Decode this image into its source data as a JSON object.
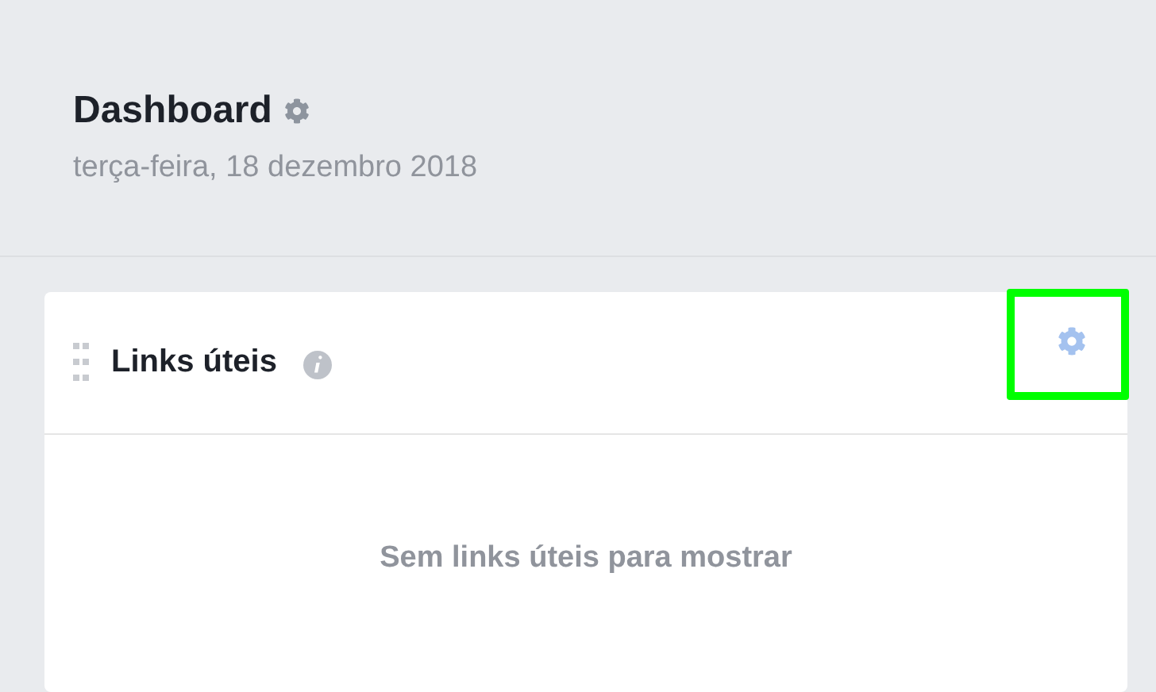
{
  "header": {
    "title": "Dashboard",
    "date": "terça-feira, 18 dezembro 2018"
  },
  "widget": {
    "title": "Links úteis",
    "settings_highlighted": true,
    "empty_message": "Sem links úteis para mostrar"
  }
}
